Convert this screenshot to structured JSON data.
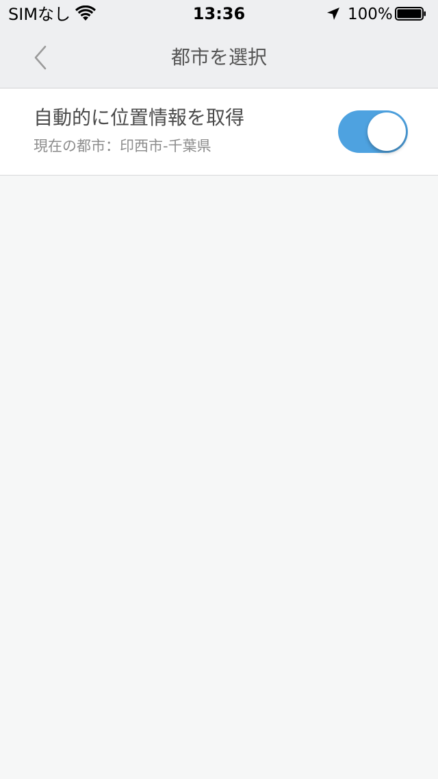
{
  "status_bar": {
    "carrier": "SIMなし",
    "time": "13:36",
    "battery_percent": "100%",
    "icons": [
      "wifi-icon",
      "location-arrow-icon",
      "battery-icon"
    ]
  },
  "nav": {
    "title": "都市を選択",
    "back_icon": "chevron-left-icon"
  },
  "settings": {
    "auto_location_label": "自動的に位置情報を取得",
    "current_city_text": "現在の都市：印西市-千葉県",
    "toggle_on": true
  },
  "colors": {
    "accent": "#4ea2e0",
    "background": "#f6f7f7",
    "header": "#eeeff1"
  }
}
